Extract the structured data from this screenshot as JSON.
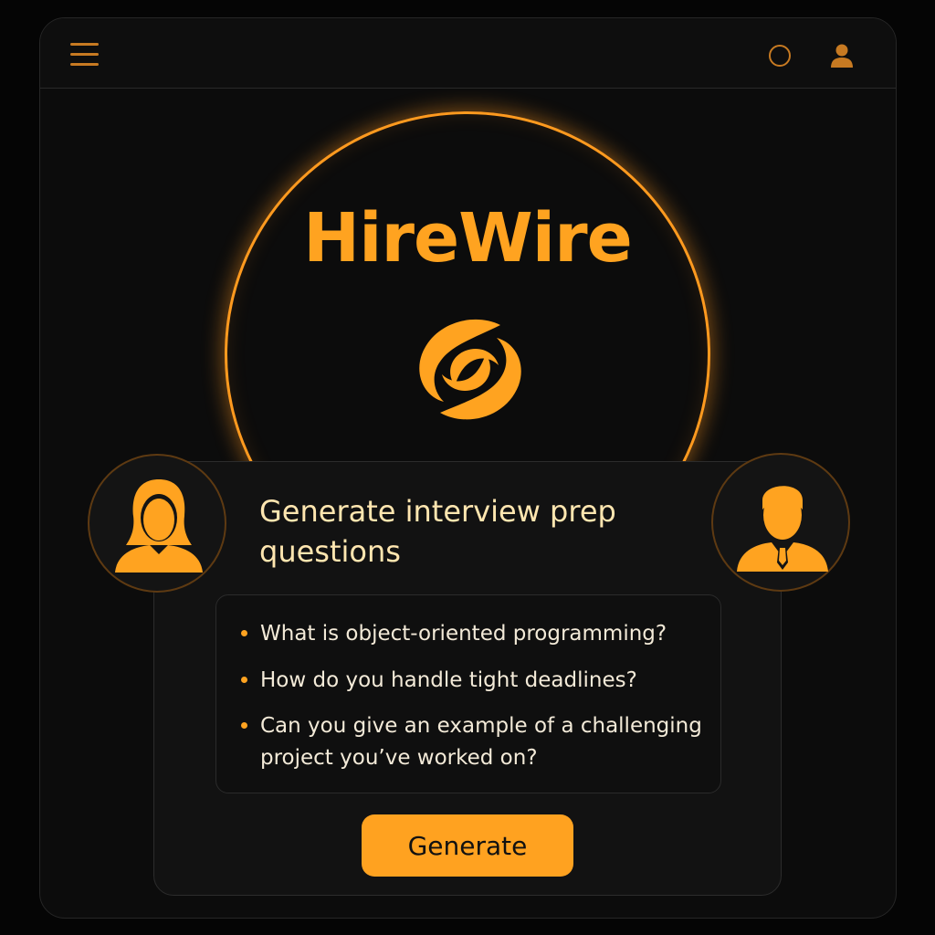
{
  "app": {
    "name": "HireWire"
  },
  "topbar": {
    "menu_icon": "hamburger-menu-icon",
    "search_icon": "search-circle-icon",
    "profile_icon": "user-profile-icon"
  },
  "logo": {
    "icon": "swirl-logo-icon"
  },
  "card": {
    "title": "Generate interview prep questions",
    "questions": [
      "What is object-oriented programming?",
      "How do you handle tight deadlines?",
      "Can you give an example of a challenging project you’ve worked on?"
    ],
    "button_label": "Generate",
    "left_avatar_icon": "female-user-icon",
    "right_avatar_icon": "male-user-suit-icon"
  },
  "colors": {
    "accent": "#ffa320",
    "button": "#ffa220",
    "background": "#050505",
    "title_text": "#ffe6b0"
  }
}
